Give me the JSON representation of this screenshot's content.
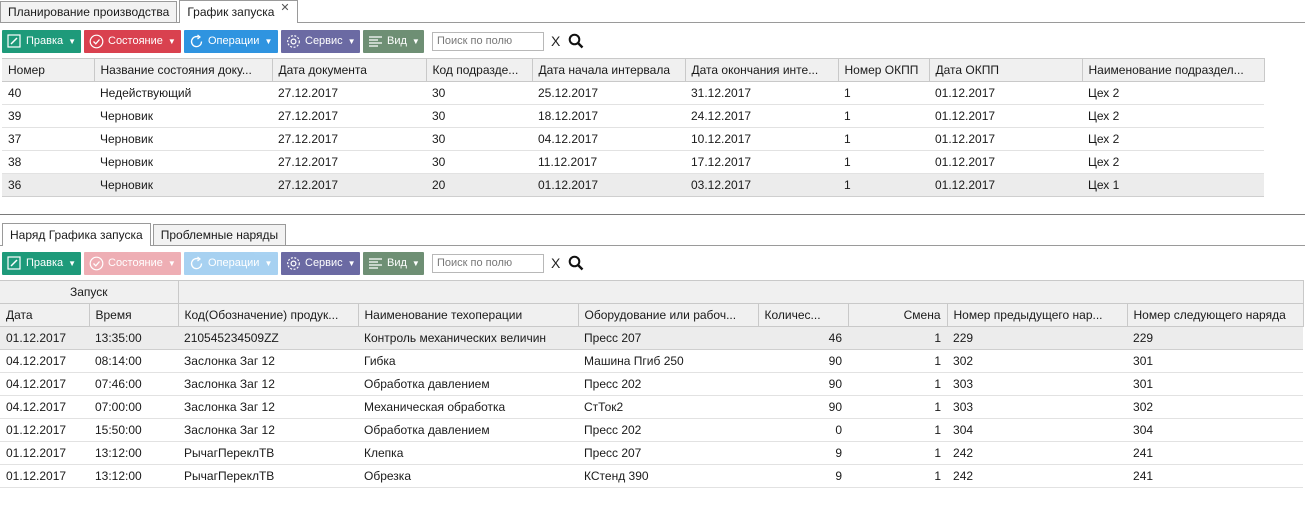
{
  "tabs": [
    {
      "label": "Планирование производства",
      "active": false
    },
    {
      "label": "График запуска",
      "active": true,
      "close": "✕"
    }
  ],
  "toolbar": {
    "edit": "Правка",
    "state": "Состояние",
    "ops": "Операции",
    "service": "Сервис",
    "view": "Вид",
    "search_placeholder": "Поиск по полю",
    "clear": "X"
  },
  "colors": {
    "edit": "#1e9a7a",
    "state": "#d9414f",
    "ops": "#2f94e0",
    "service": "#6b6aa3",
    "view": "#6e8f74"
  },
  "top_grid": {
    "columns": [
      "Номер",
      "Название состояния доку...",
      "Дата документа",
      "Код подразде...",
      "Дата начала интервала",
      "Дата окончания инте...",
      "Номер ОКПП",
      "Дата ОКПП",
      "Наименование подраздел..."
    ],
    "rows": [
      [
        "40",
        "Недействующий",
        "27.12.2017",
        "30",
        "25.12.2017",
        "31.12.2017",
        "1",
        "01.12.2017",
        "Цех 2"
      ],
      [
        "39",
        "Черновик",
        "27.12.2017",
        "30",
        "18.12.2017",
        "24.12.2017",
        "1",
        "01.12.2017",
        "Цех 2"
      ],
      [
        "37",
        "Черновик",
        "27.12.2017",
        "30",
        "04.12.2017",
        "10.12.2017",
        "1",
        "01.12.2017",
        "Цех 2"
      ],
      [
        "38",
        "Черновик",
        "27.12.2017",
        "30",
        "11.12.2017",
        "17.12.2017",
        "1",
        "01.12.2017",
        "Цех 2"
      ],
      [
        "36",
        "Черновик",
        "27.12.2017",
        "20",
        "01.12.2017",
        "03.12.2017",
        "1",
        "01.12.2017",
        "Цех 1"
      ]
    ],
    "selected_row": 4
  },
  "bottom_tabs": [
    {
      "label": "Наряд Графика запуска",
      "active": true
    },
    {
      "label": "Проблемные наряды",
      "active": false
    }
  ],
  "bottom_grid": {
    "group_header": "Запуск",
    "columns": [
      "Дата",
      "Время",
      "Код(Обозначение) продук...",
      "Наименование техоперации",
      "Оборудование или рабоч...",
      "Количес...",
      "Смена",
      "Номер предыдущего нар...",
      "Номер следующего наряда"
    ],
    "rows": [
      [
        "01.12.2017",
        "13:35:00",
        "210545234509ZZ",
        "Контроль механических величин",
        "Пресс 207",
        "46",
        "1",
        "229",
        "229"
      ],
      [
        "04.12.2017",
        "08:14:00",
        "Заслонка Заг 12",
        "Гибка",
        "Машина Пгиб 250",
        "90",
        "1",
        "302",
        "301"
      ],
      [
        "04.12.2017",
        "07:46:00",
        "Заслонка Заг 12",
        "Обработка давлением",
        "Пресс 202",
        "90",
        "1",
        "303",
        "301"
      ],
      [
        "04.12.2017",
        "07:00:00",
        "Заслонка Заг 12",
        "Механическая обработка",
        "СтТок2",
        "90",
        "1",
        "303",
        "302"
      ],
      [
        "01.12.2017",
        "15:50:00",
        "Заслонка Заг 12",
        "Обработка давлением",
        "Пресс 202",
        "0",
        "1",
        "304",
        "304"
      ],
      [
        "01.12.2017",
        "13:12:00",
        "РычагПереклТВ",
        "Клепка",
        "Пресс 207",
        "9",
        "1",
        "242",
        "241"
      ],
      [
        "01.12.2017",
        "13:12:00",
        "РычагПереклТВ",
        "Обрезка",
        "КСтенд 390",
        "9",
        "1",
        "242",
        "241"
      ]
    ],
    "selected_row": 0
  }
}
